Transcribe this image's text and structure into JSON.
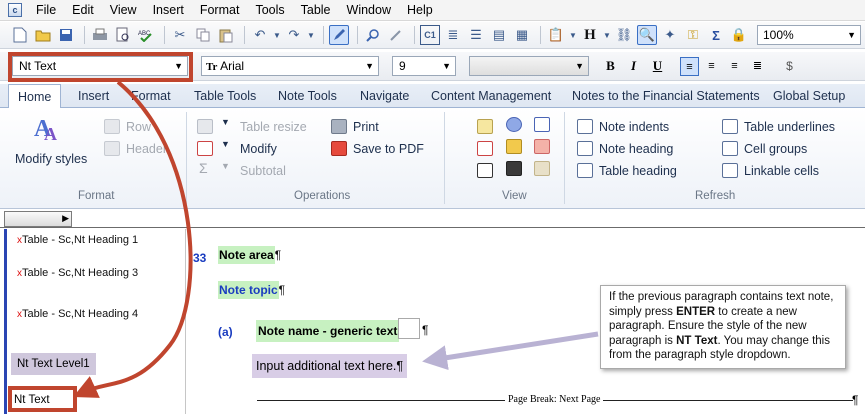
{
  "menubar": {
    "items": [
      "File",
      "Edit",
      "View",
      "Insert",
      "Format",
      "Tools",
      "Table",
      "Window",
      "Help"
    ]
  },
  "toolbar1": {
    "icons": [
      "new-icon",
      "open-icon",
      "save-icon",
      "print-icon",
      "print-preview-icon",
      "spellcheck-icon",
      "cut-icon",
      "copy-icon",
      "paste-icon",
      "undo-icon",
      "redo-icon",
      "pen-icon",
      "find-icon",
      "replace-icon",
      "c1-icon",
      "table-icon",
      "H"
    ],
    "zoom": "100%"
  },
  "toolbar2": {
    "paragraph_style": "Nt Text",
    "font": "Arial",
    "font_size": "9",
    "bold": "B",
    "italic": "I",
    "underline": "U"
  },
  "ribbon": {
    "tabs": [
      "Home",
      "Insert",
      "Format",
      "Table Tools",
      "Note Tools",
      "Navigate",
      "Content Management",
      "Notes to the Financial Statements",
      "Global Setup"
    ],
    "active_tab": "Home",
    "format": {
      "modify_styles": "Modify styles",
      "row": "Row",
      "header": "Header",
      "group_label": "Format"
    },
    "operations": {
      "table_resize": "Table resize",
      "modify": "Modify",
      "subtotal": "Subtotal",
      "print": "Print",
      "save_pdf": "Save to PDF",
      "group_label": "Operations"
    },
    "view": {
      "group_label": "View"
    },
    "refresh": {
      "note_indents": "Note indents",
      "note_heading": "Note heading",
      "table_heading": "Table heading",
      "table_underlines": "Table underlines",
      "cell_groups": "Cell groups",
      "linkable_cells": "Linkable cells",
      "group_label": "Refresh"
    }
  },
  "stylepane": {
    "marker": "x",
    "rows": [
      "Table - Sc,Nt Heading 1",
      "Table - Sc,Nt Heading 3",
      "Table - Sc,Nt Heading 4"
    ],
    "level_chip": "Nt Text Level1",
    "current": "Nt Text"
  },
  "document": {
    "note_number": "33",
    "note_area": "Note area",
    "note_topic": "Note topic",
    "para_label": "(a)",
    "note_name": "Note name - generic text",
    "input_text": "Input additional text here.",
    "pilcrow": "¶",
    "page_break": "Page Break: Next Page"
  },
  "callout": {
    "text_1": "If the previous paragraph contains text note, simply press ",
    "enter": "ENTER",
    "text_2": " to create a new paragraph. Ensure the style of the new paragraph is ",
    "nt_text": "NT Text",
    "text_3": ". You may change this from the paragraph style dropdown."
  },
  "colors": {
    "annotation_red": "#c0452e",
    "callout_arrow": "#b9b2d3",
    "note_green": "#c7f1c1",
    "style_purple": "#d8cde6"
  }
}
